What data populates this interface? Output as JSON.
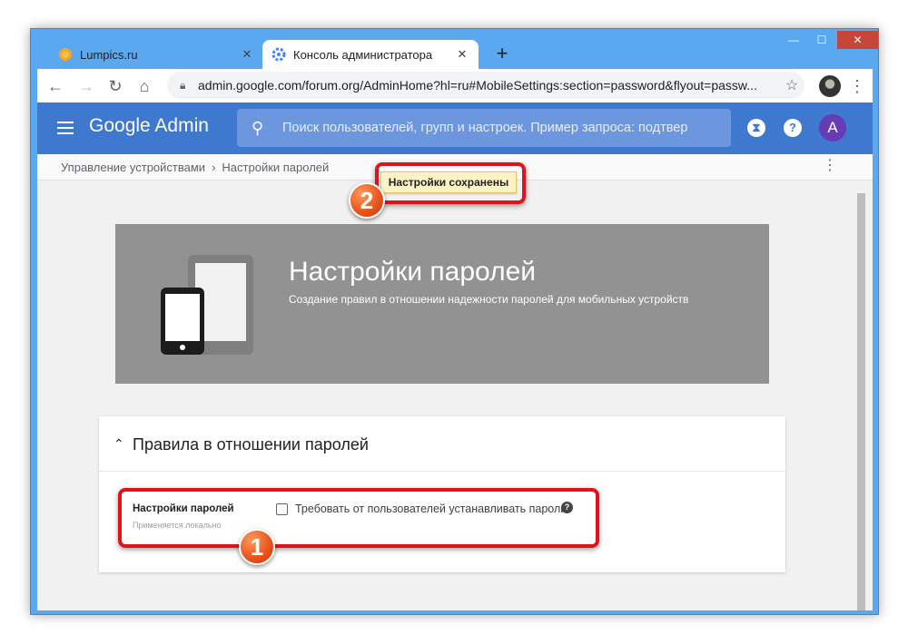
{
  "browser": {
    "tabs": [
      {
        "title": "Lumpics.ru",
        "favicon": "orange-icon",
        "active": false
      },
      {
        "title": "Консоль администратора",
        "favicon": "admin-gear-icon",
        "active": true
      }
    ],
    "new_tab_label": "+",
    "url": "admin.google.com/forum.org/AdminHome?hl=ru#MobileSettings:section=password&flyout=passw..."
  },
  "app": {
    "brand": "Google Admin",
    "search_placeholder": "Поиск пользователей, групп и настроек. Пример запроса: подтвер",
    "avatar_letter": "A"
  },
  "breadcrumb": {
    "items": [
      "Управление устройствами",
      "Настройки паролей"
    ],
    "separator": "›"
  },
  "toast": {
    "message": "Настройки сохранены"
  },
  "hero": {
    "title": "Настройки паролей",
    "subtitle": "Создание правил в отношении надежности паролей для мобильных устройств"
  },
  "card": {
    "title": "Правила в отношении паролей",
    "setting": {
      "label": "Настройки паролей",
      "sublabel": "Применяется локально",
      "checkbox_label": "Требовать от пользователей устанавливать пароли",
      "checked": false
    }
  },
  "annotations": {
    "badge_1": "1",
    "badge_2": "2",
    "highlight_color": "#e0121a"
  },
  "colors": {
    "appbar": "#3f78cf",
    "avatar": "#673ab7",
    "hero": "#929292"
  }
}
